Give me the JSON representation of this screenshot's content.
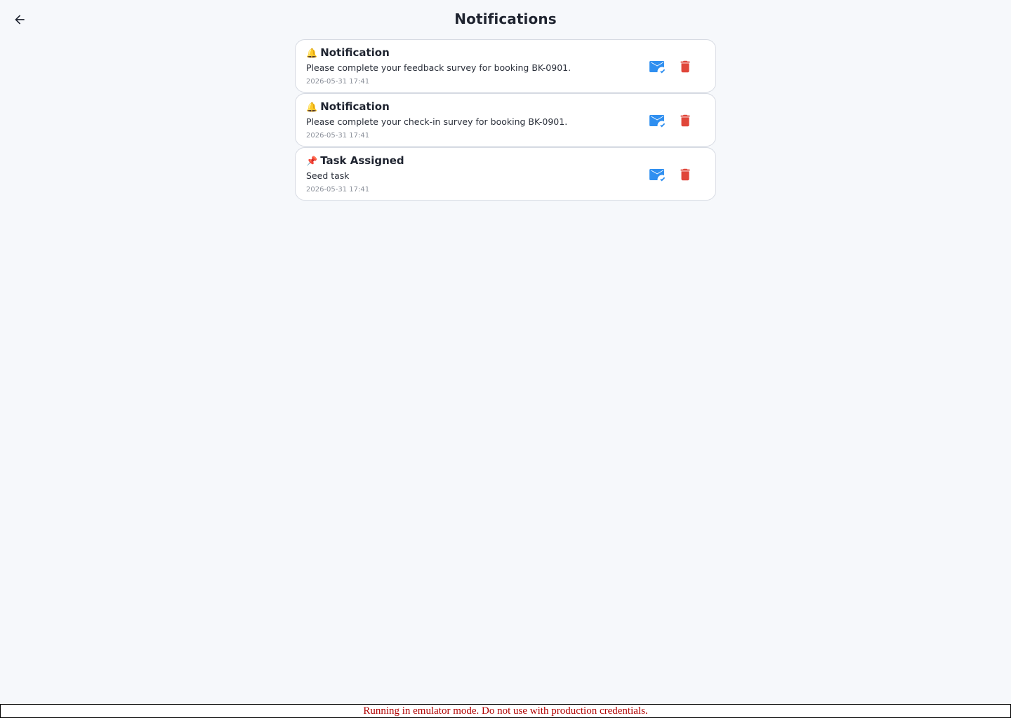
{
  "header": {
    "title": "Notifications",
    "back_icon": "arrow-left-icon"
  },
  "notifications": [
    {
      "emoji": "🔔",
      "icon": "bell-icon",
      "title": "Notification",
      "message": "Please complete your feedback survey for booking BK-0901.",
      "timestamp": "2026-05-31 17:41"
    },
    {
      "emoji": "🔔",
      "icon": "bell-icon",
      "title": "Notification",
      "message": "Please complete your check-in survey for booking BK-0901.",
      "timestamp": "2026-05-31 17:41"
    },
    {
      "emoji": "📌",
      "icon": "pushpin-icon",
      "title": "Task Assigned",
      "message": "Seed task",
      "timestamp": "2026-05-31 17:41"
    }
  ],
  "actions": {
    "mark_read_icon": "mark-email-read-icon",
    "delete_icon": "trash-icon"
  },
  "colors": {
    "background": "#f6f8fb",
    "mark_read": "#2f8ff0",
    "delete": "#e0463a",
    "banner_text": "#b00000"
  },
  "footer": {
    "banner": "Running in emulator mode. Do not use with production credentials."
  }
}
